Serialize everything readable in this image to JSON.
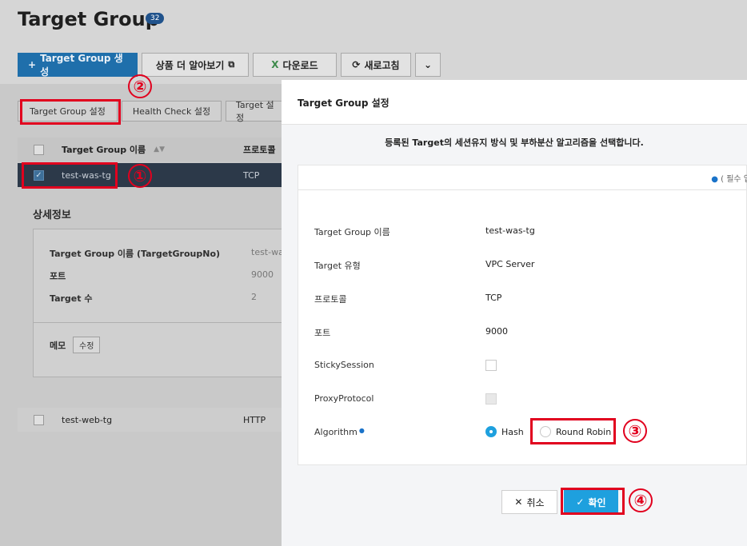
{
  "page": {
    "title": "Target Group",
    "count": "32"
  },
  "toolbar": {
    "create_label": "Target Group 생성",
    "learn_more_label": "상품 더 알아보기",
    "download_label": "다운로드",
    "refresh_label": "새로고침"
  },
  "tabs": [
    "Target Group 설정",
    "Health Check 설정",
    "Target 설정"
  ],
  "table": {
    "headers": [
      "Target Group 이름",
      "프로토콜"
    ],
    "rows": [
      {
        "name": "test-was-tg",
        "protocol": "TCP",
        "selected": true
      },
      {
        "name": "test-web-tg",
        "protocol": "HTTP",
        "selected": false
      }
    ]
  },
  "detail": {
    "title": "상세정보",
    "rows": [
      {
        "label": "Target Group 이름 (TargetGroupNo)",
        "value": "test-wa"
      },
      {
        "label": "포트",
        "value": "9000"
      },
      {
        "label": "Target 수",
        "value": "2"
      }
    ],
    "memo_label": "메모",
    "memo_button": "수정"
  },
  "modal": {
    "title": "Target Group 설정",
    "description": "등록된 Target의 세션유지 방식 및 부하분산 알고리즘을 선택합니다.",
    "required_note": "( 필수 입",
    "fields": [
      {
        "label": "Target Group 이름",
        "value": "test-was-tg"
      },
      {
        "label": "Target 유형",
        "value": "VPC Server"
      },
      {
        "label": "프로토콜",
        "value": "TCP"
      },
      {
        "label": "포트",
        "value": "9000"
      }
    ],
    "sticky_label": "StickySession",
    "proxy_label": "ProxyProtocol",
    "algorithm_label": "Algorithm",
    "algorithm_options": [
      "Hash",
      "Round Robin"
    ],
    "algorithm_selected": "Hash",
    "cancel_label": "취소",
    "ok_label": "확인"
  },
  "annotations": [
    "①",
    "②",
    "③",
    "④"
  ],
  "colors": {
    "primary": "#1f6fab",
    "confirm": "#1ea0de",
    "highlight": "#e1001e",
    "selected_row": "#2c3949"
  }
}
